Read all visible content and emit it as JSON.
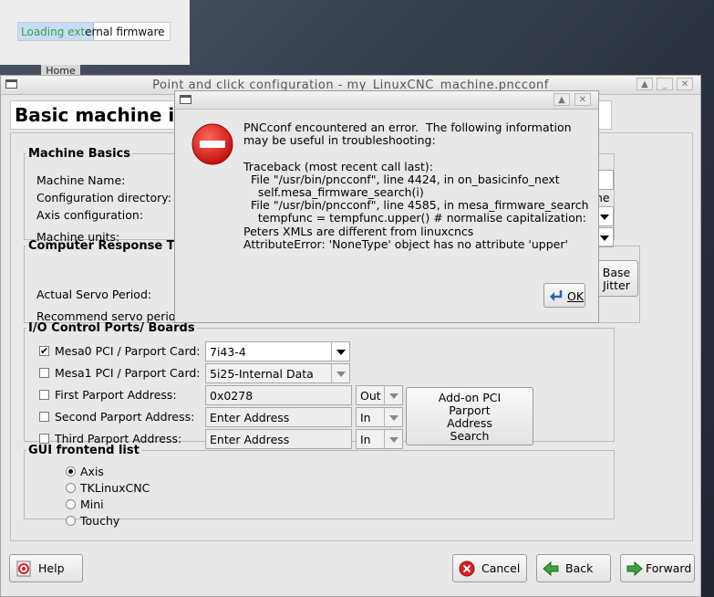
{
  "loading": {
    "text_done": "Loading ext",
    "text_rest": "ernal firmware",
    "progress_percent": 50
  },
  "home_tab": {
    "label": "Home"
  },
  "main": {
    "title": "Point and click configuration - my_LinuxCNC_machine.pncconf",
    "heading": "Basic machine i",
    "machine_basics": {
      "legend": "Machine Basics",
      "machine_name_label": "Machine Name:",
      "config_dir_label": "Configuration directory:",
      "config_dir_tail": "ne",
      "axis_config_label": "Axis configuration:",
      "machine_units_label": "Machine units:"
    },
    "response": {
      "legend": "Computer Response Tim",
      "servo_period_label": "Actual Servo Period:",
      "recommend_label": "Recommend servo perioc",
      "base_jitter_line1": "Base",
      "base_jitter_line2": "Jitter"
    },
    "io": {
      "legend": "I/O Control Ports/ Boards",
      "mesa0_label": "Mesa0 PCI / Parport Card:",
      "mesa0_value": "7i43-4",
      "mesa0_checked": true,
      "mesa1_label": "Mesa1 PCI / Parport Card:",
      "mesa1_value": "5i25-Internal Data",
      "mesa1_checked": false,
      "first_label": "First Parport Address:",
      "first_value": "0x0278",
      "first_dir": "Out",
      "second_label": "Second Parport Address:",
      "second_placeholder": "Enter Address",
      "second_dir": "In",
      "third_label": "Third Parport Address:",
      "third_placeholder": "Enter Address",
      "third_dir": "In",
      "addon_line1": "Add-on PCI",
      "addon_line2": "Parport",
      "addon_line3": "Address",
      "addon_line4": "Search"
    },
    "gui": {
      "legend": "GUI frontend list",
      "options": [
        "Axis",
        "TKLinuxCNC",
        "Mini",
        "Touchy"
      ],
      "selected": "Axis"
    },
    "buttons": {
      "help": "Help",
      "cancel": "Cancel",
      "back": "Back",
      "forward": "Forward"
    }
  },
  "error_dialog": {
    "message": "PNCconf encountered an error.  The following information\nmay be useful in troubleshooting:\n\nTraceback (most recent call last):\n  File \"/usr/bin/pncconf\", line 4424, in on_basicinfo_next\n    self.mesa_firmware_search(i)\n  File \"/usr/bin/pncconf\", line 4585, in mesa_firmware_search\n    tempfunc = tempfunc.upper() # normalise capitalization:\nPeters XMLs are different from linuxcncs\nAttributeError: 'NoneType' object has no attribute 'upper'",
    "ok_label": "OK"
  },
  "colors": {
    "error_red": "#d9201f",
    "loading_green": "#3aa14a"
  }
}
